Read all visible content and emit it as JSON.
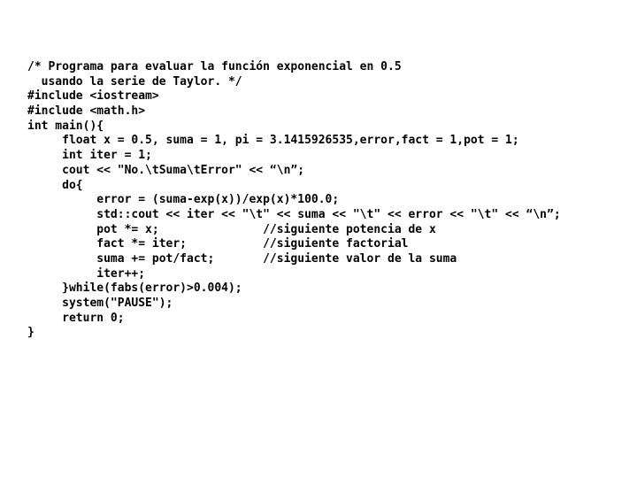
{
  "document": {
    "kind": "source-code-listing",
    "language": "C++",
    "background_color": "#ffffff",
    "text_color": "#000000",
    "font_weight": "bold",
    "font_style": "monospace"
  },
  "code": {
    "lines": [
      "/* Programa para evaluar la función exponencial en 0.5",
      "  usando la serie de Taylor. */",
      "#include <iostream>",
      "#include <math.h>",
      "int main(){",
      "     float x = 0.5, suma = 1, pi = 3.1415926535,error,fact = 1,pot = 1;",
      "     int iter = 1;",
      "     cout << \"No.\\tSuma\\tError\" << “\\n”;",
      "     do{",
      "          error = (suma-exp(x))/exp(x)*100.0;",
      "          std::cout << iter << \"\\t\" << suma << \"\\t\" << error << \"\\t\" << “\\n”;",
      "          pot *= x;               //siguiente potencia de x",
      "          fact *= iter;           //siguiente factorial",
      "          suma += pot/fact;       //siguiente valor de la suma",
      "          iter++;",
      "     }while(fabs(error)>0.004);",
      "     system(\"PAUSE\");",
      "     return 0;",
      "}"
    ]
  }
}
